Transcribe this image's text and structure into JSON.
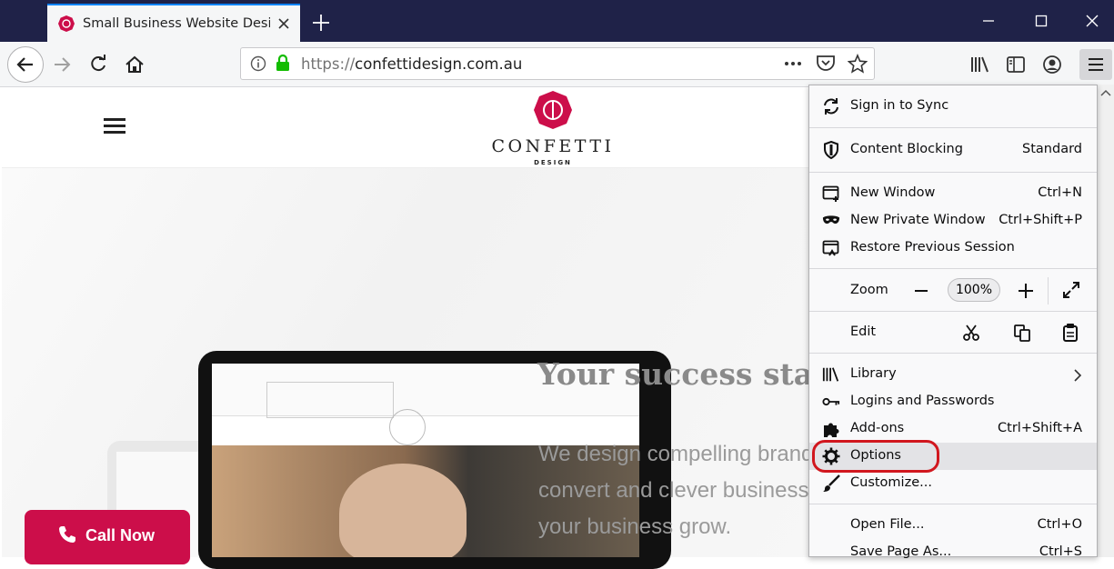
{
  "tab": {
    "title": "Small Business Website Design"
  },
  "url": {
    "prefix": "https://",
    "domain": "confettidesign.com.au"
  },
  "site": {
    "brand": "CONFETTI",
    "brand_sub": "DESIGN",
    "headline": "Your success star",
    "body_lines": [
      "We design compelling brand",
      "convert and clever business",
      "your business grow."
    ],
    "call_button": "Call Now"
  },
  "menu": {
    "sign_in": "Sign in to Sync",
    "content_blocking": {
      "label": "Content Blocking",
      "value": "Standard"
    },
    "new_window": {
      "label": "New Window",
      "shortcut": "Ctrl+N"
    },
    "new_private": {
      "label": "New Private Window",
      "shortcut": "Ctrl+Shift+P"
    },
    "restore": {
      "label": "Restore Previous Session"
    },
    "zoom": {
      "label": "Zoom",
      "value": "100%"
    },
    "edit": {
      "label": "Edit"
    },
    "library": {
      "label": "Library"
    },
    "logins": {
      "label": "Logins and Passwords"
    },
    "addons": {
      "label": "Add-ons",
      "shortcut": "Ctrl+Shift+A"
    },
    "options": {
      "label": "Options"
    },
    "customize": {
      "label": "Customize..."
    },
    "open_file": {
      "label": "Open File...",
      "shortcut": "Ctrl+O"
    },
    "save_page": {
      "label": "Save Page As...",
      "shortcut": "Ctrl+S"
    }
  },
  "colors": {
    "accent": "#cc0e4a",
    "highlight": "#d1171e",
    "titlebar": "#1f2248"
  }
}
